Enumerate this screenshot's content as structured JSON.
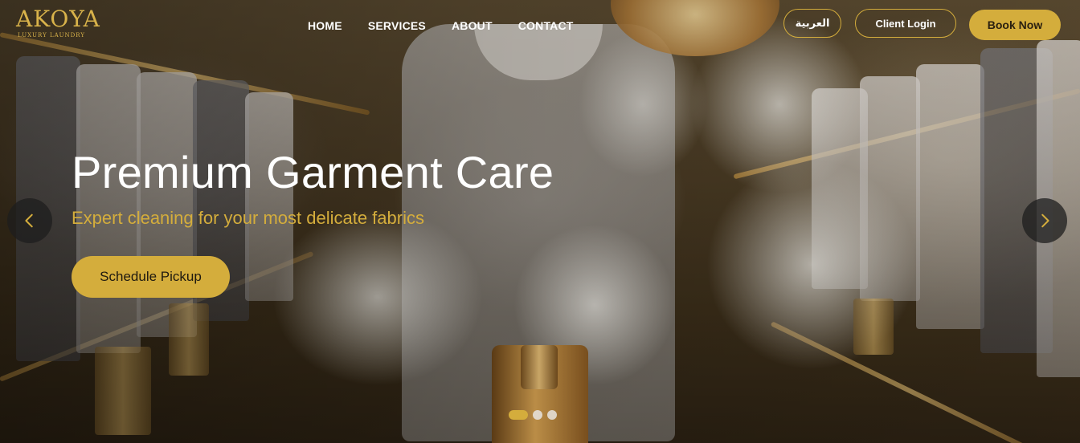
{
  "brand": {
    "name": "AKOYA",
    "tagline": "LUXURY LAUNDRY"
  },
  "nav": {
    "links": [
      {
        "label": "HOME"
      },
      {
        "label": "SERVICES"
      },
      {
        "label": "ABOUT"
      },
      {
        "label": "CONTACT"
      }
    ],
    "language_label": "العربية",
    "login_label": "Client Login",
    "book_label": "Book Now"
  },
  "hero": {
    "title": "Premium Garment Care",
    "subtitle": "Expert cleaning for your most delicate fabrics",
    "cta_label": "Schedule Pickup"
  },
  "carousel": {
    "slide_count": 3,
    "active_index": 0,
    "prev_icon": "chevron-left-icon",
    "next_icon": "chevron-right-icon"
  },
  "colors": {
    "accent": "#d4ad3c",
    "text_light": "#ffffff",
    "arrow_bg": "#1e1e1e"
  }
}
